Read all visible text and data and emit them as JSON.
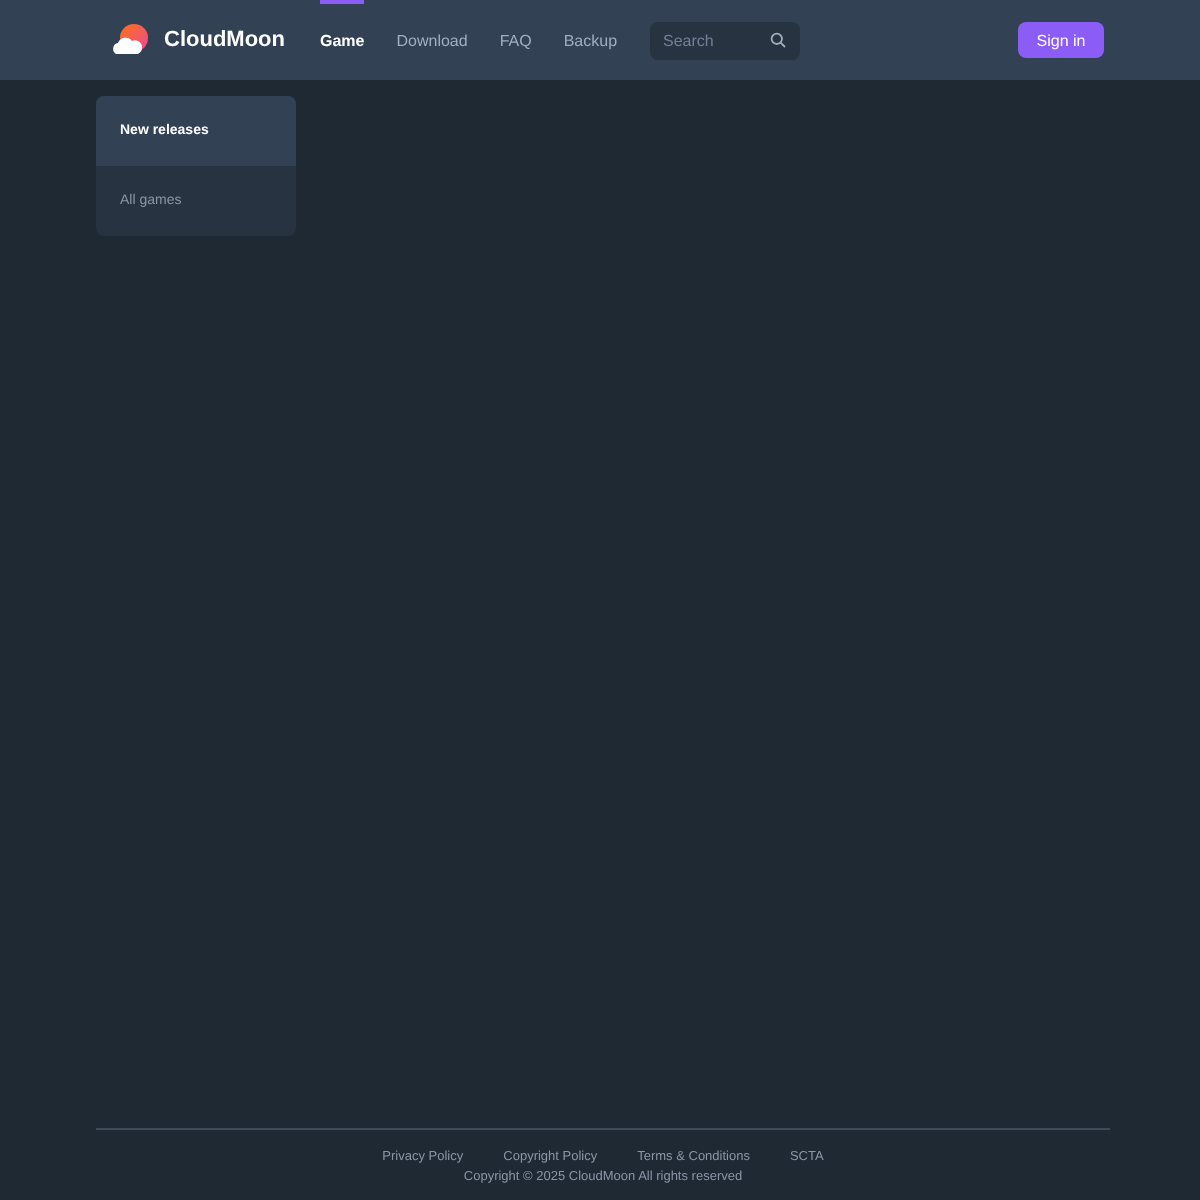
{
  "header": {
    "brand": "CloudMoon",
    "nav": [
      {
        "label": "Game",
        "selected": true
      },
      {
        "label": "Download",
        "selected": false
      },
      {
        "label": "FAQ",
        "selected": false
      },
      {
        "label": "Backup",
        "selected": false
      }
    ],
    "search": {
      "placeholder": "Search"
    },
    "sign_in": "Sign in"
  },
  "sidebar": {
    "items": [
      {
        "label": "New releases",
        "selected": true
      },
      {
        "label": "All games",
        "selected": false
      }
    ]
  },
  "footer": {
    "links": [
      "Privacy Policy",
      "Copyright Policy",
      "Terms & Conditions",
      "SCTA"
    ],
    "copyright": "Copyright © 2025 CloudMoon All rights reserved"
  }
}
